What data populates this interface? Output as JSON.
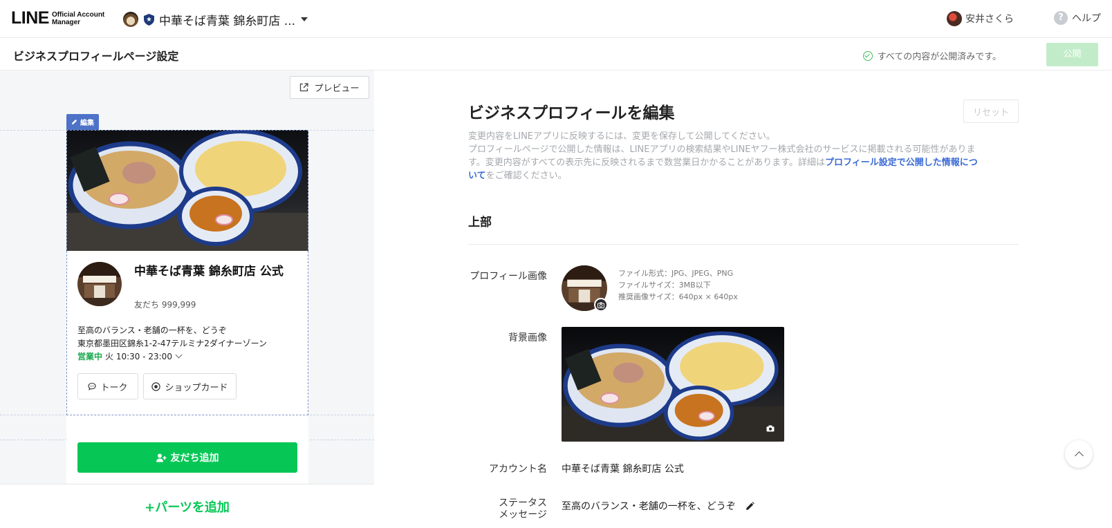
{
  "header": {
    "logo_line": "LINE",
    "logo_sub_1": "Official Account",
    "logo_sub_2": "Manager",
    "account_name": "中華そば青葉 錦糸町店 ...",
    "user_name": "安井さくら",
    "help_icon": "?",
    "help_label": "ヘルプ"
  },
  "subheader": {
    "page_title": "ビジネスプロフィールページ設定",
    "status": "すべての内容が公開済みです。",
    "publish_label": "公開"
  },
  "preview": {
    "preview_label": "プレビュー",
    "edit_tag": "編集",
    "name": "中華そば青葉 錦糸町店 公式",
    "friends": "友だち 999,999",
    "status_message": "至高のバランス・老舗の一杯を、どうぞ",
    "address": "東京都墨田区錦糸1-2-47テルミナ2ダイナーゾーン",
    "open_label": "営業中",
    "hours": "火 10:30 - 23:00",
    "talk_label": "トーク",
    "shopcard_label": "ショップカード",
    "add_friend_label": "友だち追加",
    "add_parts_label": "+パーツを追加"
  },
  "editor": {
    "title": "ビジネスプロフィールを編集",
    "reset_label": "リセット",
    "desc_line1": "変更内容をLINEアプリに反映するには、変更を保存して公開してください。",
    "desc_line2_pre": "プロフィールページで公開した情報は、LINEアプリの検索結果やLINEヤフー株式会社のサービスに掲載される可能性がありま",
    "desc_line2_mid": "す。変更内容がすべての表示先に反映されるまで数営業日かかることがあります。詳細は",
    "desc_link": "プロフィール設定で公開した情報につ",
    "desc_link_2": "いて",
    "desc_tail": "をご確認ください。",
    "section_title": "上部",
    "profile_image_label": "プロフィール画像",
    "file_format": "ファイル形式：JPG、JPEG、PNG",
    "file_size": "ファイルサイズ：3MB以下",
    "recommended_size": "推奨画像サイズ：640px × 640px",
    "bg_image_label": "背景画像",
    "account_name_label": "アカウント名",
    "account_name_value": "中華そば青葉 錦糸町店 公式",
    "status_label_1": "ステータス",
    "status_label_2": "メッセージ",
    "status_value": "至高のバランス・老舗の一杯を、どうぞ"
  },
  "colors": {
    "line_green": "#06c755",
    "publish_disabled": "#c2ecc9",
    "link_blue": "#3b6bd4",
    "edit_tag_blue": "#4d72c8",
    "open_green": "#17a84a"
  }
}
